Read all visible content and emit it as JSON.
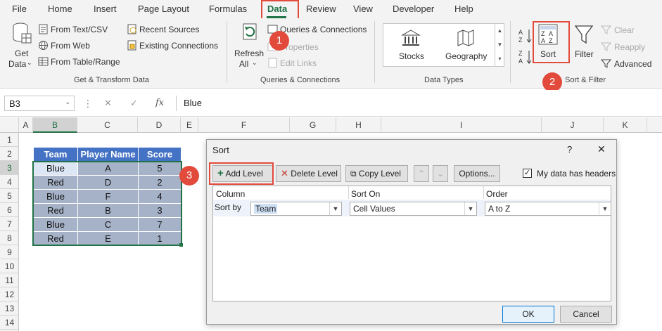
{
  "ribbon_tabs": [
    "File",
    "Home",
    "Insert",
    "Page Layout",
    "Formulas",
    "Data",
    "Review",
    "View",
    "Developer",
    "Help"
  ],
  "active_tab": "Data",
  "ribbon": {
    "get_data": [
      "Get",
      "Data"
    ],
    "from_text_csv": "From Text/CSV",
    "from_web": "From Web",
    "from_table_range": "From Table/Range",
    "recent_sources": "Recent Sources",
    "existing_connections": "Existing Connections",
    "group_get_transform": "Get & Transform Data",
    "refresh_all": [
      "Refresh",
      "All"
    ],
    "queries_connections": "Queries & Connections",
    "properties": "Properties",
    "edit_links": "Edit Links",
    "group_queries": "Queries & Connections",
    "stocks": "Stocks",
    "geography": "Geography",
    "group_data_types": "Data Types",
    "sort": "Sort",
    "filter": "Filter",
    "clear": "Clear",
    "reapply": "Reapply",
    "advanced": "Advanced",
    "group_sort_filter": "Sort & Filter"
  },
  "callouts": [
    "1",
    "2",
    "3"
  ],
  "formula_bar": {
    "name_box": "B3",
    "fx": "fx",
    "value": "Blue"
  },
  "columns": [
    "A",
    "B",
    "C",
    "D",
    "E",
    "F",
    "G",
    "H",
    "I",
    "J",
    "K"
  ],
  "rows": [
    "1",
    "2",
    "3",
    "4",
    "5",
    "6",
    "7",
    "8",
    "9",
    "10",
    "11",
    "12",
    "13",
    "14"
  ],
  "table": {
    "headers": [
      "Team",
      "Player Name",
      "Score"
    ],
    "rows": [
      [
        "Blue",
        "A",
        "5"
      ],
      [
        "Red",
        "D",
        "2"
      ],
      [
        "Blue",
        "F",
        "4"
      ],
      [
        "Red",
        "B",
        "3"
      ],
      [
        "Blue",
        "C",
        "7"
      ],
      [
        "Red",
        "E",
        "1"
      ]
    ]
  },
  "dialog": {
    "title": "Sort",
    "help": "?",
    "close": "✕",
    "add_level": "Add Level",
    "delete_level": "Delete Level",
    "copy_level": "Copy Level",
    "options": "Options...",
    "headers_checkbox": "My data has headers",
    "headers_checked": true,
    "col_header": "Column",
    "sorton_header": "Sort On",
    "order_header": "Order",
    "sort_by": "Sort by",
    "column_value": "Team",
    "sorton_value": "Cell Values",
    "order_value": "A to Z",
    "ok": "OK",
    "cancel": "Cancel"
  },
  "colors": {
    "accent": "#217346",
    "callout": "#e24a3b",
    "table_header": "#4472c4",
    "table_body": "#a6b2c8"
  }
}
